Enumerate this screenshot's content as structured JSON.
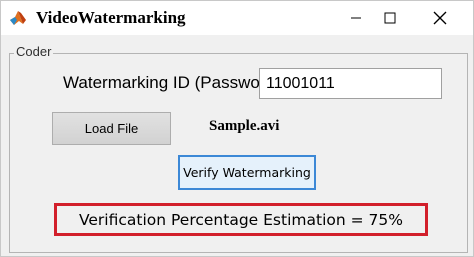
{
  "window": {
    "title": "VideoWatermarking",
    "app_icon": "matlab-logo-icon",
    "controls": [
      "minimize-icon",
      "maximize-icon",
      "close-icon"
    ]
  },
  "panel": {
    "title": "Coder"
  },
  "watermark_id": {
    "label": "Watermarking ID (Password)",
    "value": "11001011"
  },
  "load_file": {
    "button_label": "Load File",
    "file_name": "Sample.avi"
  },
  "verify": {
    "button_label": "Verify Watermarking"
  },
  "result": {
    "text": "Verification Percentage Estimation = 75%"
  },
  "colors": {
    "highlight_border": "#d21f2b",
    "focus_border": "#3c88d6"
  }
}
